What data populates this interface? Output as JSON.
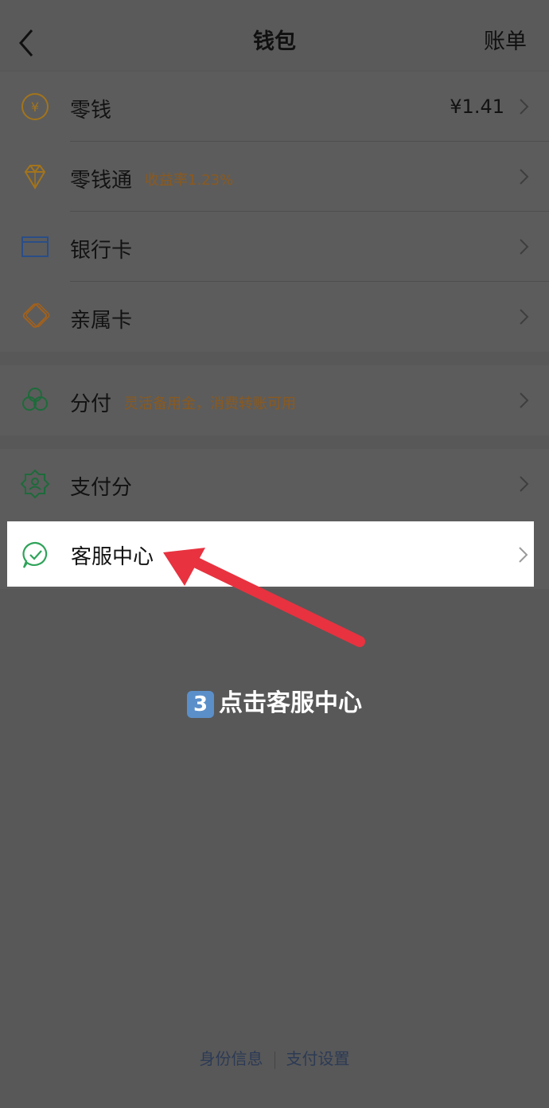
{
  "header": {
    "title": "钱包",
    "right_label": "账单"
  },
  "groups": {
    "g1": [
      {
        "label": "零钱",
        "value": "¥1.41",
        "icon": "coin-yen-icon"
      },
      {
        "label": "零钱通",
        "sub": "收益率1.23%",
        "icon": "diamond-icon"
      },
      {
        "label": "银行卡",
        "icon": "bank-card-icon"
      },
      {
        "label": "亲属卡",
        "icon": "family-card-icon"
      }
    ],
    "g2": [
      {
        "label": "分付",
        "sub": "灵活备用金，消费转账可用",
        "icon": "clover-icon"
      }
    ],
    "g3": [
      {
        "label": "支付分",
        "icon": "score-badge-icon"
      },
      {
        "label": "客服中心",
        "icon": "customer-service-icon"
      }
    ]
  },
  "annotation": {
    "badge": "3",
    "text": "点击客服中心"
  },
  "footer": {
    "identity": "身份信息",
    "pay_settings": "支付设置"
  },
  "colors": {
    "background": "#585858",
    "highlight": "#ffffff",
    "arrow": "#e8323f",
    "accent_orange": "#8a5a20"
  }
}
